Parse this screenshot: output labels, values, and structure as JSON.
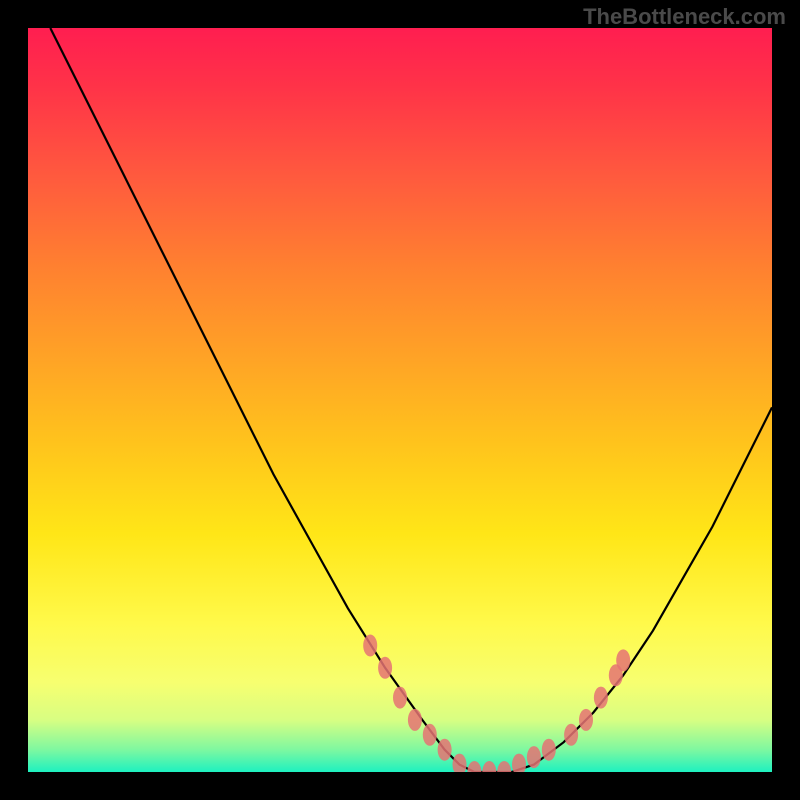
{
  "watermark": "TheBottleneck.com",
  "chart_data": {
    "type": "line",
    "title": "",
    "xlabel": "",
    "ylabel": "",
    "xlim": [
      0,
      100
    ],
    "ylim": [
      0,
      100
    ],
    "grid": false,
    "legend": false,
    "background_gradient": [
      "#ff1e50",
      "#ff5a3e",
      "#ffa226",
      "#ffe617",
      "#f7ff70",
      "#1ef1c0"
    ],
    "series": [
      {
        "name": "curve",
        "x": [
          3,
          8,
          13,
          18,
          23,
          28,
          33,
          38,
          43,
          48,
          53,
          56,
          58,
          60,
          62,
          65,
          68,
          72,
          76,
          80,
          84,
          88,
          92,
          96,
          100
        ],
        "y": [
          100,
          90,
          80,
          70,
          60,
          50,
          40,
          31,
          22,
          14,
          7,
          3,
          1,
          0,
          0,
          0,
          1,
          4,
          8,
          13,
          19,
          26,
          33,
          41,
          49
        ]
      }
    ],
    "markers": [
      {
        "x": 46,
        "y": 17
      },
      {
        "x": 48,
        "y": 14
      },
      {
        "x": 50,
        "y": 10
      },
      {
        "x": 52,
        "y": 7
      },
      {
        "x": 54,
        "y": 5
      },
      {
        "x": 56,
        "y": 3
      },
      {
        "x": 58,
        "y": 1
      },
      {
        "x": 60,
        "y": 0
      },
      {
        "x": 62,
        "y": 0
      },
      {
        "x": 64,
        "y": 0
      },
      {
        "x": 66,
        "y": 1
      },
      {
        "x": 68,
        "y": 2
      },
      {
        "x": 70,
        "y": 3
      },
      {
        "x": 73,
        "y": 5
      },
      {
        "x": 75,
        "y": 7
      },
      {
        "x": 77,
        "y": 10
      },
      {
        "x": 79,
        "y": 13
      },
      {
        "x": 80,
        "y": 15
      }
    ]
  }
}
